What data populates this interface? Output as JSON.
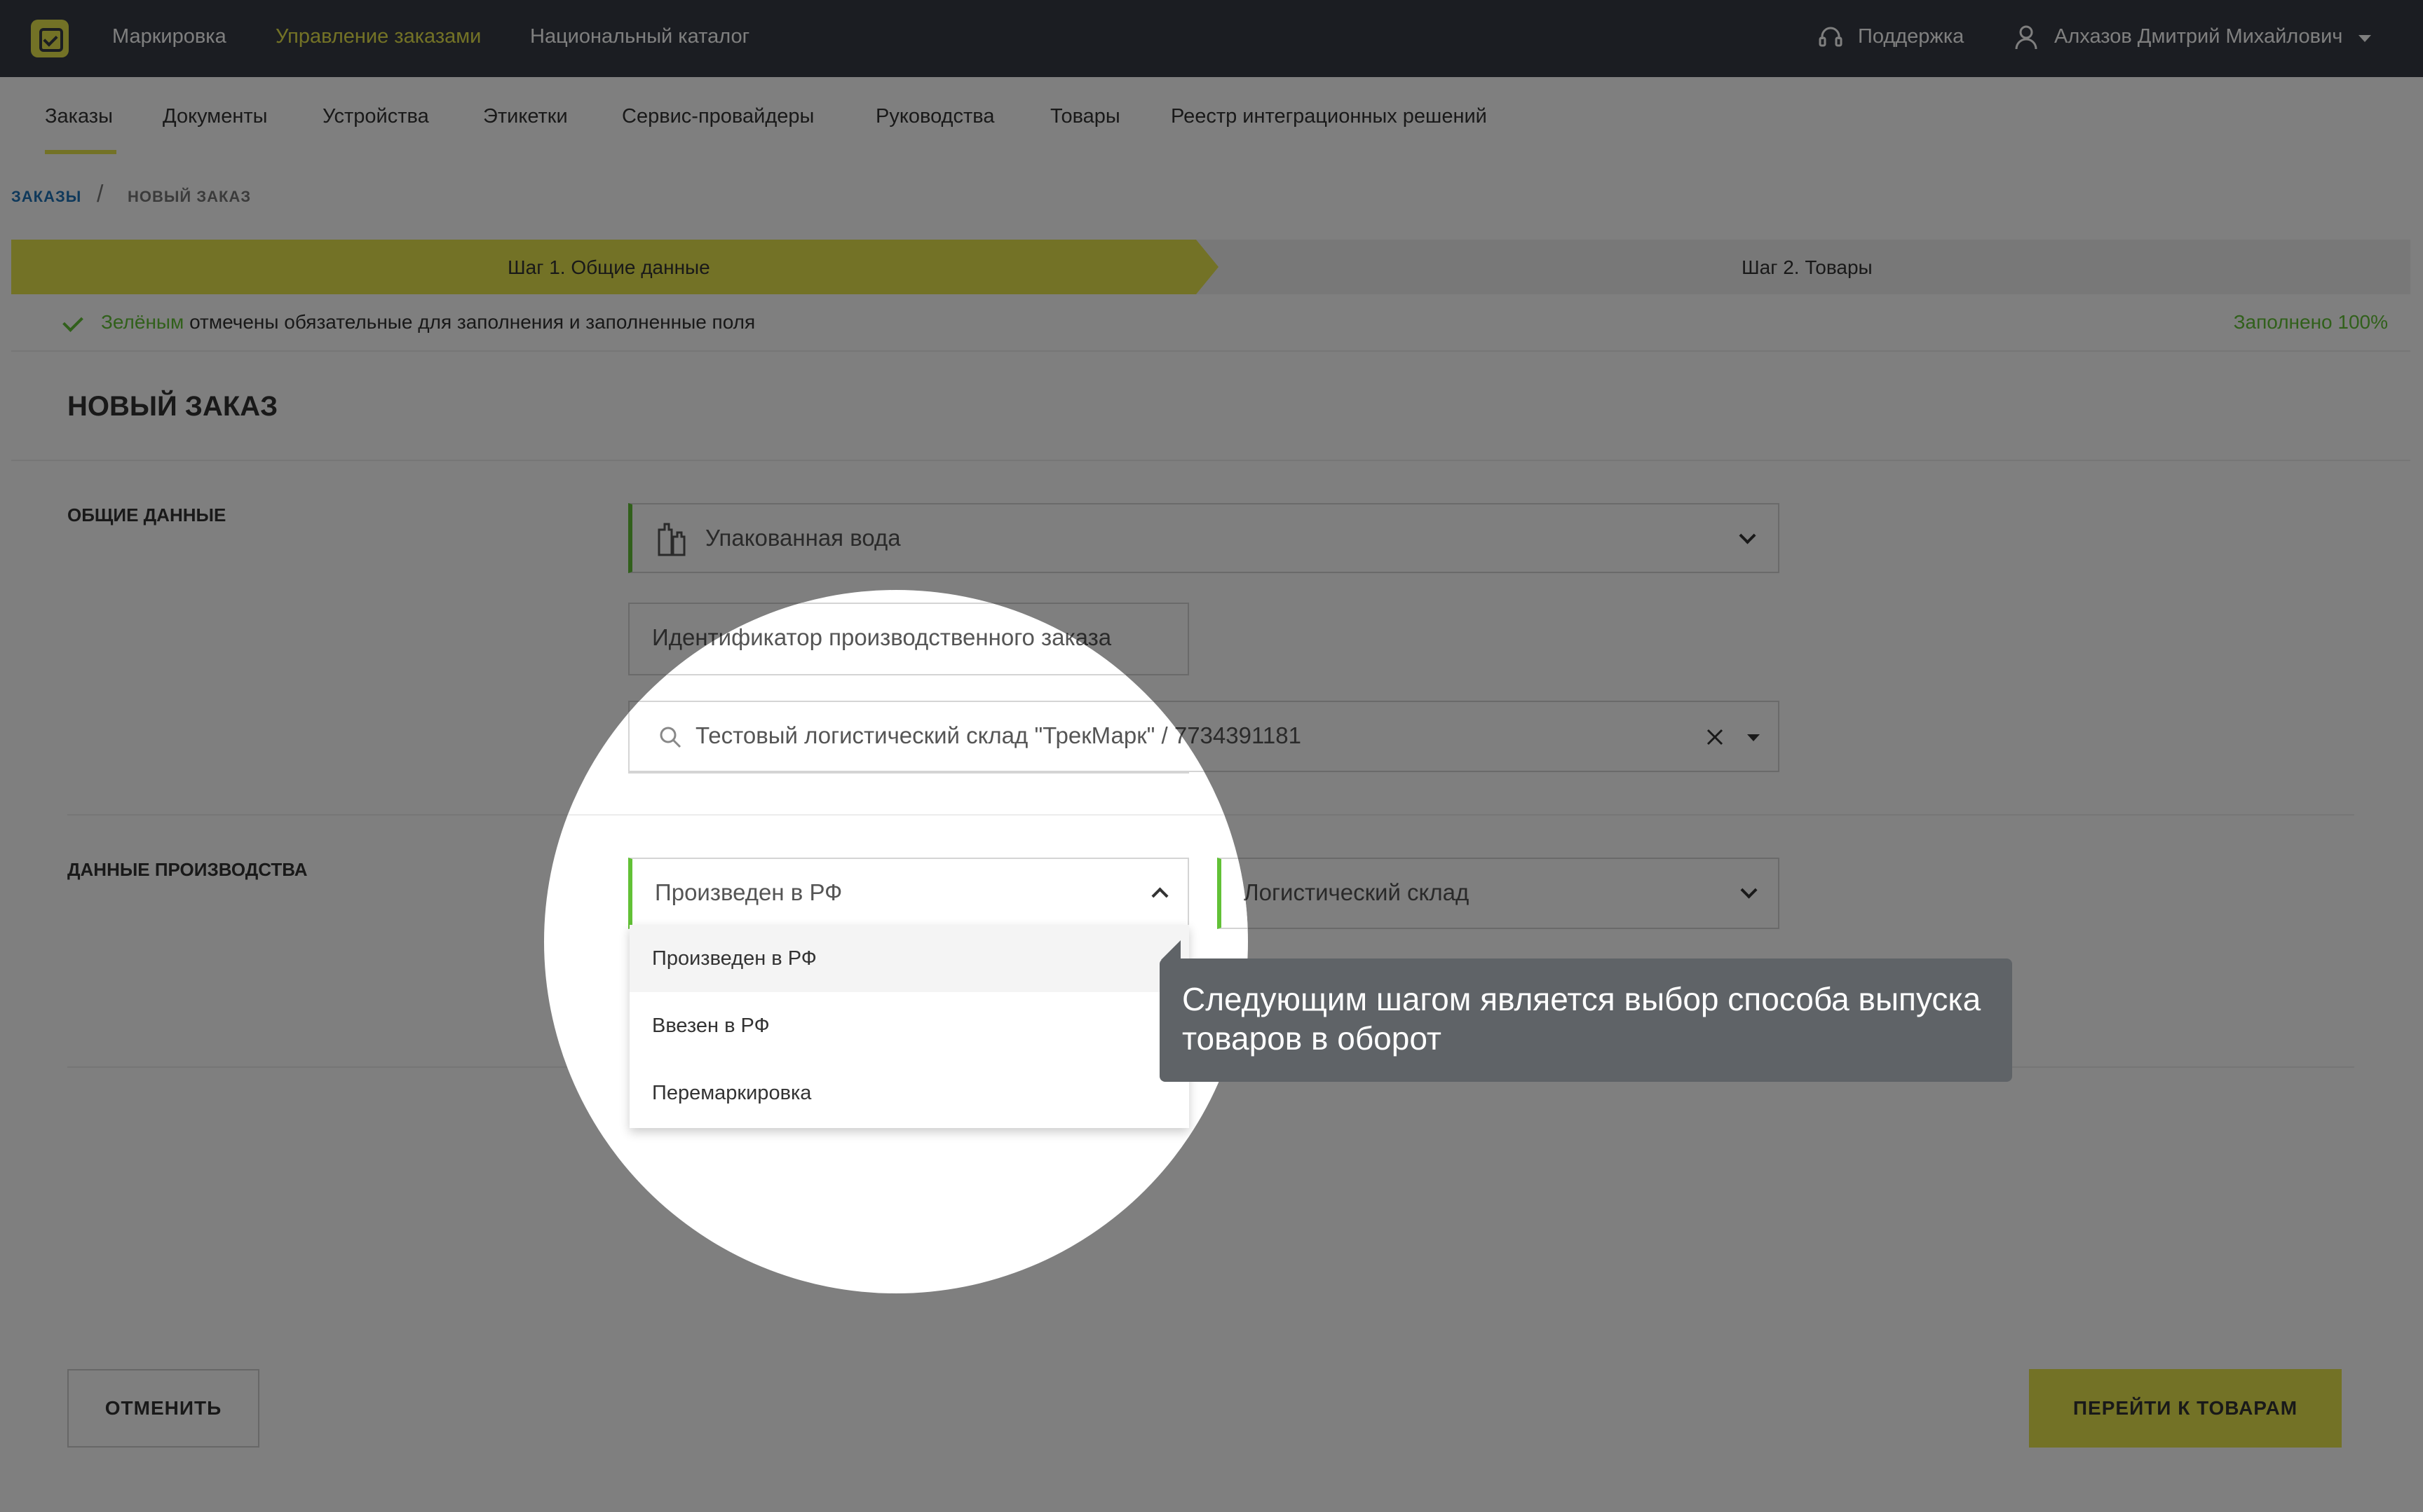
{
  "header": {
    "nav": [
      "Маркировка",
      "Управление заказами",
      "Национальный каталог"
    ],
    "support": "Поддержка",
    "user": "Алхазов Дмитрий Михайлович"
  },
  "subnav": [
    "Заказы",
    "Документы",
    "Устройства",
    "Этикетки",
    "Сервис-провайдеры",
    "Руководства",
    "Товары",
    "Реестр интеграционных решений"
  ],
  "breadcrumb": {
    "parent": "ЗАКАЗЫ",
    "current": "НОВЫЙ ЗАКАЗ"
  },
  "steps": {
    "step1": "Шаг 1. Общие данные",
    "step2": "Шаг 2. Товары"
  },
  "hint": {
    "green": "Зелёным",
    "rest": "отмечены обязательные для заполнения и заполненные поля",
    "progress": "Заполнено 100%"
  },
  "title": "НОВЫЙ ЗАКАЗ",
  "general": {
    "label": "ОБЩИЕ ДАННЫЕ",
    "product_group": "Упакованная вода",
    "order_id_placeholder": "Идентификатор производственного заказа",
    "warehouse": "Тестовый логистический склад \"ТрекМарк\" / 7734391181"
  },
  "production": {
    "label": "ДАННЫЕ ПРОИЗВОДСТВА",
    "release_method": "Произведен в РФ",
    "place": "Логистический склад",
    "options": [
      "Произведен в РФ",
      "Ввезен в РФ",
      "Перемаркировка"
    ]
  },
  "tooltip": "Следующим шагом является выбор способа выпуска товаров в оборот",
  "buttons": {
    "cancel": "ОТМЕНИТЬ",
    "next": "ПЕРЕЙТИ К ТОВАРАМ"
  },
  "colors": {
    "accent": "#e6e44c",
    "required_green": "#62c136",
    "topbar": "#363b44"
  }
}
